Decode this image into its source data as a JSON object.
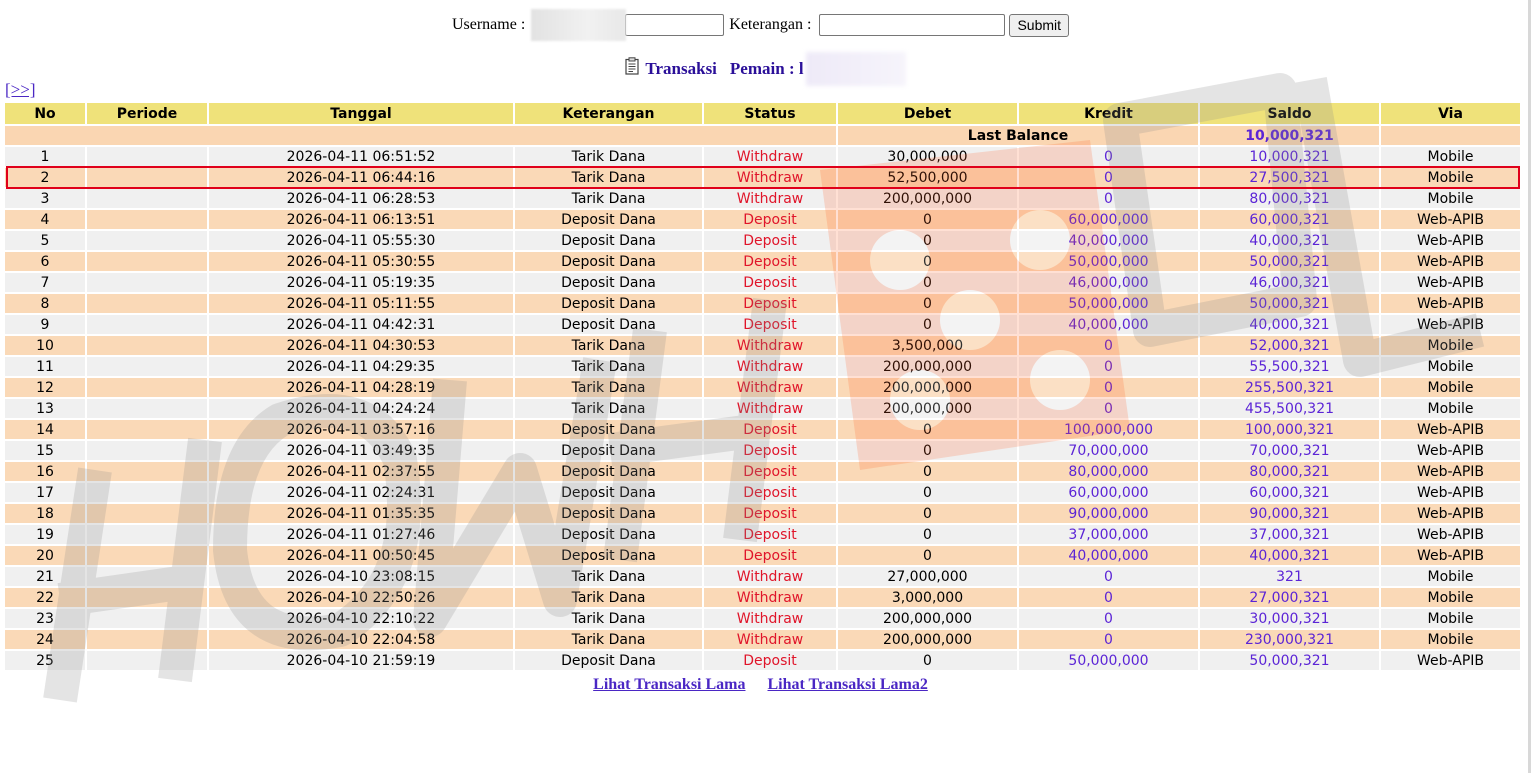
{
  "search": {
    "username_label": "Username :",
    "username_value": "",
    "keterangan_label": "Keterangan :",
    "keterangan_value": "",
    "submit_label": "Submit"
  },
  "heading": {
    "title": "Transaksi",
    "pemain_label": "Pemain : l"
  },
  "nav": {
    "next_label": "[>>]"
  },
  "table": {
    "columns": [
      "No",
      "Periode",
      "Tanggal",
      "Keterangan",
      "Status",
      "Debet",
      "Kredit",
      "Saldo",
      "Via"
    ],
    "last_balance_label": "Last Balance",
    "last_balance_value": "10,000,321",
    "rows": [
      {
        "no": "1",
        "periode": "",
        "tanggal": "2026-04-11 06:51:52",
        "keterangan": "Tarik Dana",
        "status": "Withdraw",
        "debet": "30,000,000",
        "kredit": "0",
        "saldo": "10,000,321",
        "via": "Mobile"
      },
      {
        "no": "2",
        "periode": "",
        "tanggal": "2026-04-11 06:44:16",
        "keterangan": "Tarik Dana",
        "status": "Withdraw",
        "debet": "52,500,000",
        "kredit": "0",
        "saldo": "27,500,321",
        "via": "Mobile"
      },
      {
        "no": "3",
        "periode": "",
        "tanggal": "2026-04-11 06:28:53",
        "keterangan": "Tarik Dana",
        "status": "Withdraw",
        "debet": "200,000,000",
        "kredit": "0",
        "saldo": "80,000,321",
        "via": "Mobile"
      },
      {
        "no": "4",
        "periode": "",
        "tanggal": "2026-04-11 06:13:51",
        "keterangan": "Deposit Dana",
        "status": "Deposit",
        "debet": "0",
        "kredit": "60,000,000",
        "saldo": "60,000,321",
        "via": "Web-APIB"
      },
      {
        "no": "5",
        "periode": "",
        "tanggal": "2026-04-11 05:55:30",
        "keterangan": "Deposit Dana",
        "status": "Deposit",
        "debet": "0",
        "kredit": "40,000,000",
        "saldo": "40,000,321",
        "via": "Web-APIB"
      },
      {
        "no": "6",
        "periode": "",
        "tanggal": "2026-04-11 05:30:55",
        "keterangan": "Deposit Dana",
        "status": "Deposit",
        "debet": "0",
        "kredit": "50,000,000",
        "saldo": "50,000,321",
        "via": "Web-APIB"
      },
      {
        "no": "7",
        "periode": "",
        "tanggal": "2026-04-11 05:19:35",
        "keterangan": "Deposit Dana",
        "status": "Deposit",
        "debet": "0",
        "kredit": "46,000,000",
        "saldo": "46,000,321",
        "via": "Web-APIB"
      },
      {
        "no": "8",
        "periode": "",
        "tanggal": "2026-04-11 05:11:55",
        "keterangan": "Deposit Dana",
        "status": "Deposit",
        "debet": "0",
        "kredit": "50,000,000",
        "saldo": "50,000,321",
        "via": "Web-APIB"
      },
      {
        "no": "9",
        "periode": "",
        "tanggal": "2026-04-11 04:42:31",
        "keterangan": "Deposit Dana",
        "status": "Deposit",
        "debet": "0",
        "kredit": "40,000,000",
        "saldo": "40,000,321",
        "via": "Web-APIB"
      },
      {
        "no": "10",
        "periode": "",
        "tanggal": "2026-04-11 04:30:53",
        "keterangan": "Tarik Dana",
        "status": "Withdraw",
        "debet": "3,500,000",
        "kredit": "0",
        "saldo": "52,000,321",
        "via": "Mobile"
      },
      {
        "no": "11",
        "periode": "",
        "tanggal": "2026-04-11 04:29:35",
        "keterangan": "Tarik Dana",
        "status": "Withdraw",
        "debet": "200,000,000",
        "kredit": "0",
        "saldo": "55,500,321",
        "via": "Mobile"
      },
      {
        "no": "12",
        "periode": "",
        "tanggal": "2026-04-11 04:28:19",
        "keterangan": "Tarik Dana",
        "status": "Withdraw",
        "debet": "200,000,000",
        "kredit": "0",
        "saldo": "255,500,321",
        "via": "Mobile"
      },
      {
        "no": "13",
        "periode": "",
        "tanggal": "2026-04-11 04:24:24",
        "keterangan": "Tarik Dana",
        "status": "Withdraw",
        "debet": "200,000,000",
        "kredit": "0",
        "saldo": "455,500,321",
        "via": "Mobile"
      },
      {
        "no": "14",
        "periode": "",
        "tanggal": "2026-04-11 03:57:16",
        "keterangan": "Deposit Dana",
        "status": "Deposit",
        "debet": "0",
        "kredit": "100,000,000",
        "saldo": "100,000,321",
        "via": "Web-APIB"
      },
      {
        "no": "15",
        "periode": "",
        "tanggal": "2026-04-11 03:49:35",
        "keterangan": "Deposit Dana",
        "status": "Deposit",
        "debet": "0",
        "kredit": "70,000,000",
        "saldo": "70,000,321",
        "via": "Web-APIB"
      },
      {
        "no": "16",
        "periode": "",
        "tanggal": "2026-04-11 02:37:55",
        "keterangan": "Deposit Dana",
        "status": "Deposit",
        "debet": "0",
        "kredit": "80,000,000",
        "saldo": "80,000,321",
        "via": "Web-APIB"
      },
      {
        "no": "17",
        "periode": "",
        "tanggal": "2026-04-11 02:24:31",
        "keterangan": "Deposit Dana",
        "status": "Deposit",
        "debet": "0",
        "kredit": "60,000,000",
        "saldo": "60,000,321",
        "via": "Web-APIB"
      },
      {
        "no": "18",
        "periode": "",
        "tanggal": "2026-04-11 01:35:35",
        "keterangan": "Deposit Dana",
        "status": "Deposit",
        "debet": "0",
        "kredit": "90,000,000",
        "saldo": "90,000,321",
        "via": "Web-APIB"
      },
      {
        "no": "19",
        "periode": "",
        "tanggal": "2026-04-11 01:27:46",
        "keterangan": "Deposit Dana",
        "status": "Deposit",
        "debet": "0",
        "kredit": "37,000,000",
        "saldo": "37,000,321",
        "via": "Web-APIB"
      },
      {
        "no": "20",
        "periode": "",
        "tanggal": "2026-04-11 00:50:45",
        "keterangan": "Deposit Dana",
        "status": "Deposit",
        "debet": "0",
        "kredit": "40,000,000",
        "saldo": "40,000,321",
        "via": "Web-APIB"
      },
      {
        "no": "21",
        "periode": "",
        "tanggal": "2026-04-10 23:08:15",
        "keterangan": "Tarik Dana",
        "status": "Withdraw",
        "debet": "27,000,000",
        "kredit": "0",
        "saldo": "321",
        "via": "Mobile"
      },
      {
        "no": "22",
        "periode": "",
        "tanggal": "2026-04-10 22:50:26",
        "keterangan": "Tarik Dana",
        "status": "Withdraw",
        "debet": "3,000,000",
        "kredit": "0",
        "saldo": "27,000,321",
        "via": "Mobile"
      },
      {
        "no": "23",
        "periode": "",
        "tanggal": "2026-04-10 22:10:22",
        "keterangan": "Tarik Dana",
        "status": "Withdraw",
        "debet": "200,000,000",
        "kredit": "0",
        "saldo": "30,000,321",
        "via": "Mobile"
      },
      {
        "no": "24",
        "periode": "",
        "tanggal": "2026-04-10 22:04:58",
        "keterangan": "Tarik Dana",
        "status": "Withdraw",
        "debet": "200,000,000",
        "kredit": "0",
        "saldo": "230,000,321",
        "via": "Mobile"
      },
      {
        "no": "25",
        "periode": "",
        "tanggal": "2026-04-10 21:59:19",
        "keterangan": "Deposit Dana",
        "status": "Deposit",
        "debet": "0",
        "kredit": "50,000,000",
        "saldo": "50,000,321",
        "via": "Web-APIB"
      }
    ]
  },
  "footer": {
    "link1": "Lihat Transaksi Lama",
    "link2": "Lihat Transaksi Lama2"
  },
  "colors": {
    "header_bg": "#efe27a",
    "row_odd_bg": "#f0f0f0",
    "row_even_bg": "#fad9b7",
    "status_red": "#e0152a",
    "value_purple": "#5b24d6",
    "highlight_border": "#e0001a"
  },
  "icons": {
    "heading_icon": "clipboard-icon"
  }
}
